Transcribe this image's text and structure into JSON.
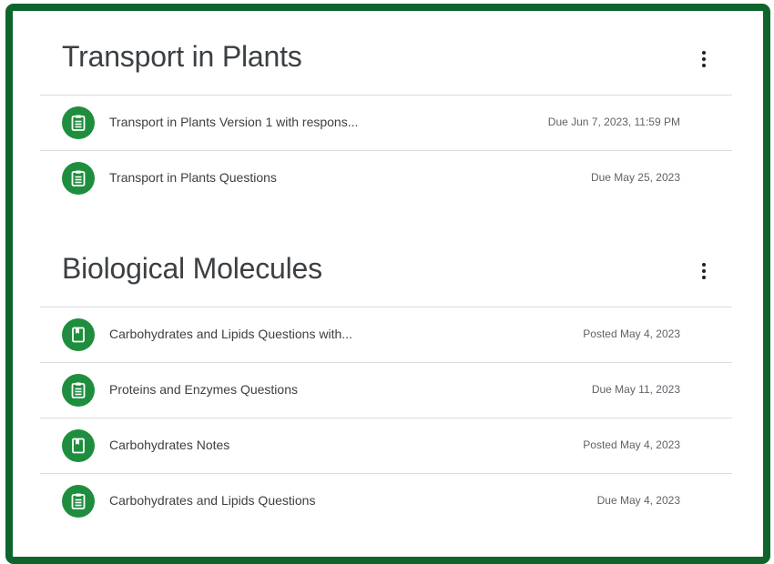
{
  "topics": [
    {
      "title": "Transport in Plants",
      "items": [
        {
          "icon": "assignment-icon",
          "title": "Transport in Plants Version 1 with respons...",
          "date": "Due Jun 7, 2023, 11:59 PM"
        },
        {
          "icon": "assignment-icon",
          "title": "Transport in Plants Questions",
          "date": "Due May 25, 2023"
        }
      ]
    },
    {
      "title": "Biological Molecules",
      "items": [
        {
          "icon": "material-icon",
          "title": "Carbohydrates and Lipids Questions with...",
          "date": "Posted May 4, 2023"
        },
        {
          "icon": "assignment-icon",
          "title": "Proteins and Enzymes Questions",
          "date": "Due May 11, 2023"
        },
        {
          "icon": "material-icon",
          "title": "Carbohydrates Notes",
          "date": "Posted May 4, 2023"
        },
        {
          "icon": "assignment-icon",
          "title": "Carbohydrates and Lipids Questions",
          "date": "Due May 4, 2023"
        }
      ]
    }
  ],
  "colors": {
    "frame_border": "#0d652d",
    "icon_background": "#1e8e3e",
    "divider": "#dadce0"
  }
}
